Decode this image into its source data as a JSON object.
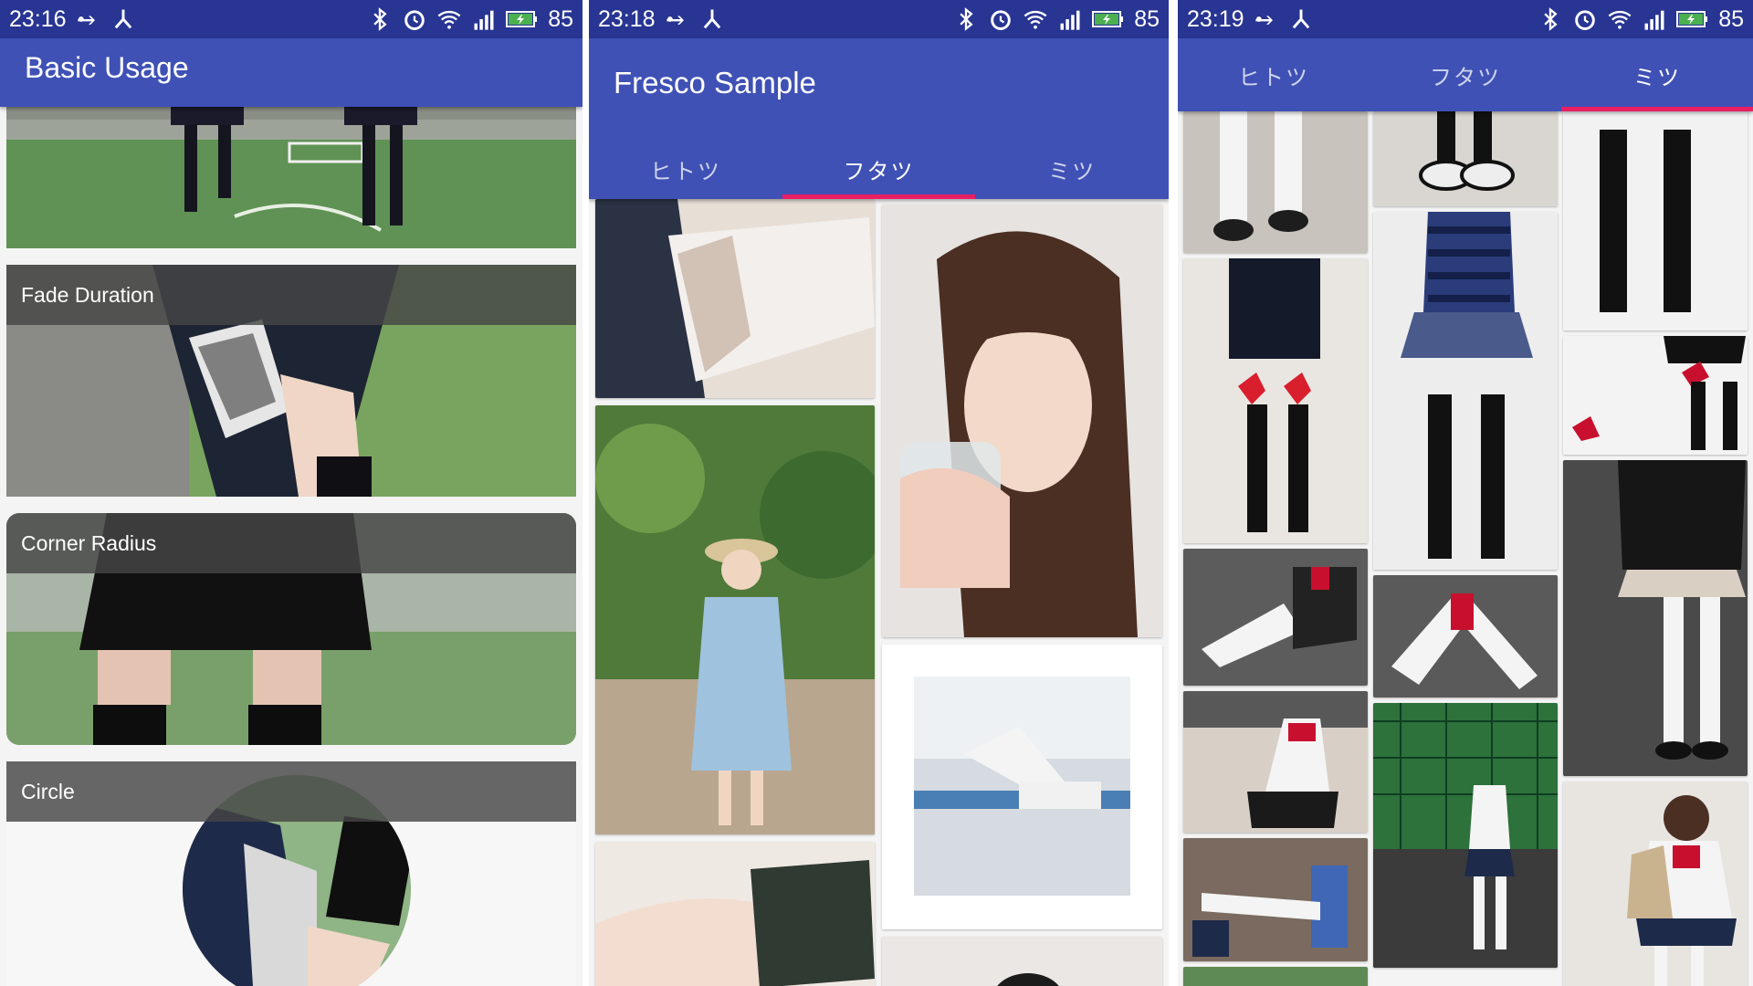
{
  "screens": [
    {
      "time": "23:16",
      "battery": "85",
      "app_title": "Basic Usage",
      "cards": [
        {
          "label": ""
        },
        {
          "label": "Fade Duration"
        },
        {
          "label": "Corner Radius"
        },
        {
          "label": "Circle"
        }
      ]
    },
    {
      "time": "23:18",
      "battery": "85",
      "app_title": "Fresco Sample",
      "tabs": [
        "ヒトツ",
        "フタツ",
        "ミツ"
      ],
      "active_tab": 1
    },
    {
      "time": "23:19",
      "battery": "85",
      "tabs": [
        "ヒトツ",
        "フタツ",
        "ミツ"
      ],
      "active_tab": 2
    }
  ],
  "colors": {
    "status_bar": "#283593",
    "app_bar": "#3f51b5",
    "tab_indicator": "#e91e63"
  },
  "icons": {
    "status_left": [
      "usb-icon",
      "debug-icon"
    ],
    "status_right": [
      "bluetooth-icon",
      "alarm-icon",
      "wifi-icon",
      "signal-4g-icon",
      "battery-icon"
    ]
  }
}
